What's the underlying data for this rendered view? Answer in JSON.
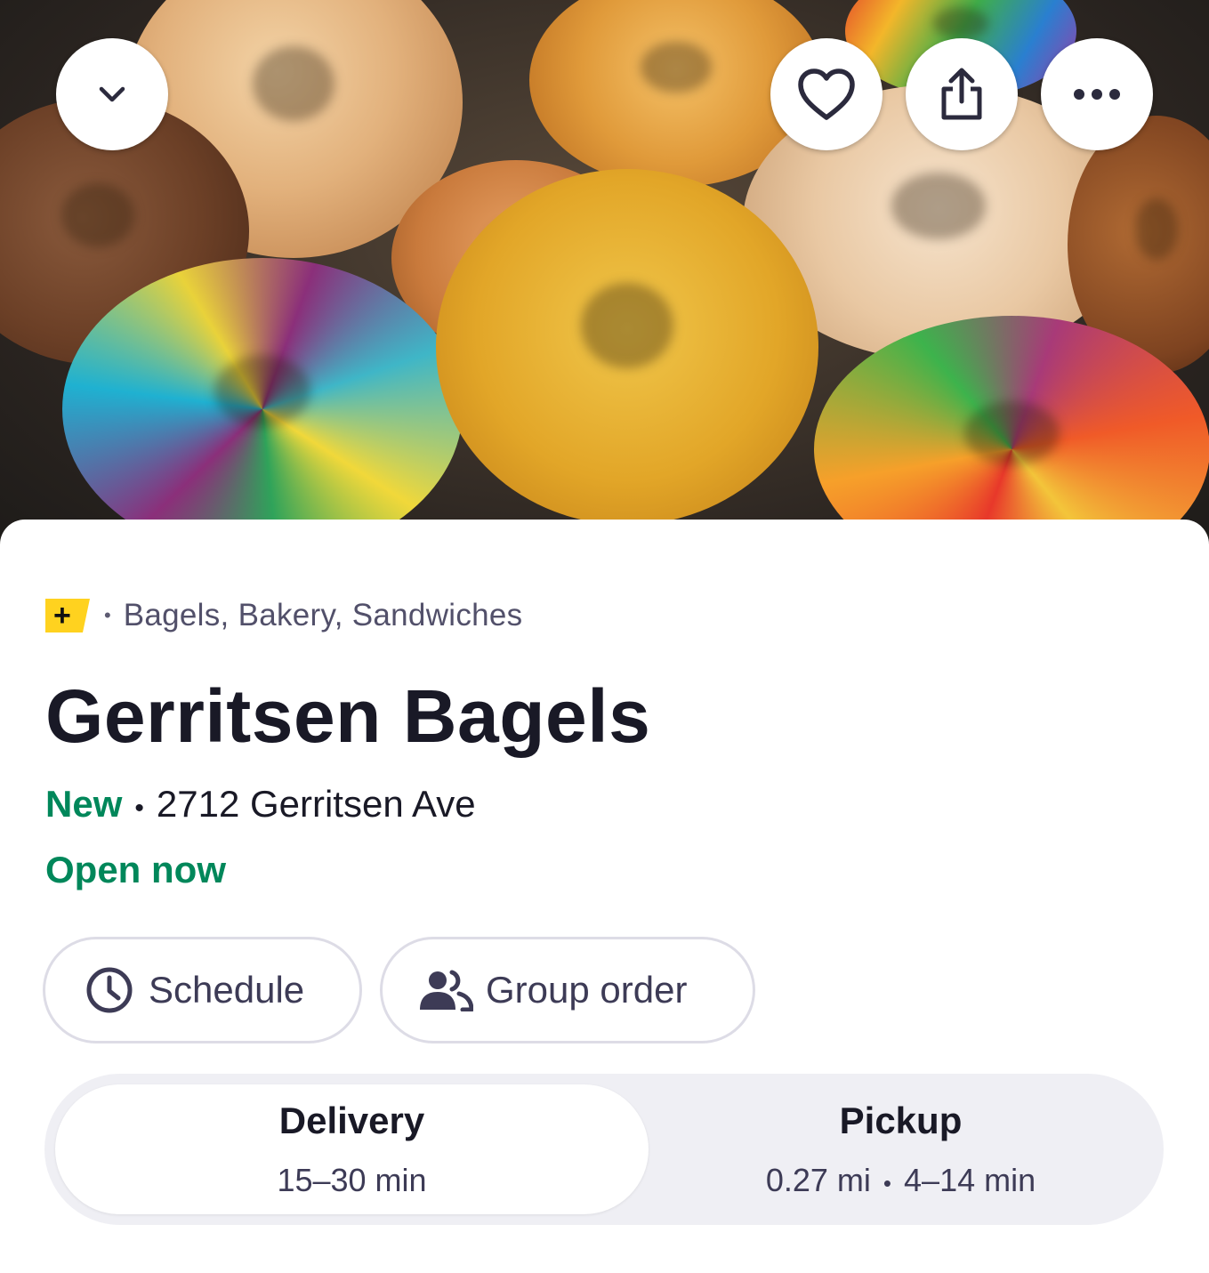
{
  "hero": {
    "buttons": {
      "collapse_icon": "chevron-down-icon",
      "favorite_icon": "heart-icon",
      "share_icon": "share-icon",
      "more_icon": "more-horizontal-icon"
    }
  },
  "store": {
    "dashpass_badge": "+",
    "separator": "•",
    "categories": "Bagels, Bakery, Sandwiches",
    "name": "Gerritsen Bagels",
    "new_label": "New",
    "address": "2712 Gerritsen Ave",
    "status": "Open now"
  },
  "actions": {
    "schedule_label": "Schedule",
    "group_order_label": "Group order"
  },
  "fulfillment": {
    "delivery": {
      "label": "Delivery",
      "time": "15–30 min"
    },
    "pickup": {
      "label": "Pickup",
      "distance": "0.27 mi",
      "time": "4–14 min"
    },
    "selected": "Delivery"
  },
  "colors": {
    "accent_green": "#00875a",
    "dashpass_yellow": "#ffd21f",
    "text_dark": "#191926"
  }
}
